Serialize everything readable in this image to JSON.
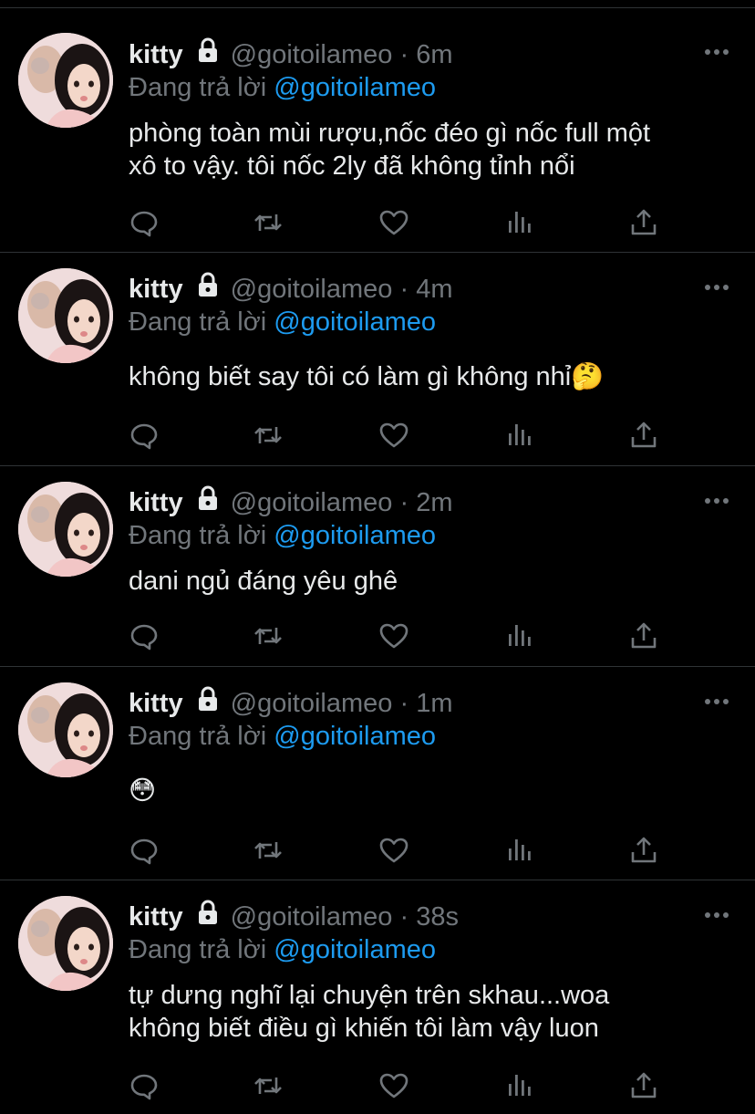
{
  "tweets": [
    {
      "name": "kitty",
      "handle": "@goitoilameo",
      "separator": "·",
      "time": "6m",
      "reply_prefix": "Đang trả lời",
      "reply_to": "@goitoilameo",
      "lines": [
        "phòng toàn mùi rượu,nốc đéo gì nốc full một",
        "xô to vậy. tôi nốc 2ly đã không tỉnh nổi"
      ]
    },
    {
      "name": "kitty",
      "handle": "@goitoilameo",
      "separator": "·",
      "time": "4m",
      "reply_prefix": "Đang trả lời",
      "reply_to": "@goitoilameo",
      "lines": [
        "không biết say tôi có làm gì không nhỉ🤔"
      ]
    },
    {
      "name": "kitty",
      "handle": "@goitoilameo",
      "separator": "·",
      "time": "2m",
      "reply_prefix": "Đang trả lời",
      "reply_to": "@goitoilameo",
      "lines": [
        "dani ngủ đáng yêu ghê"
      ]
    },
    {
      "name": "kitty",
      "handle": "@goitoilameo",
      "separator": "·",
      "time": "1m",
      "reply_prefix": "Đang trả lời",
      "reply_to": "@goitoilameo",
      "lines": [
        "😳"
      ]
    },
    {
      "name": "kitty",
      "handle": "@goitoilameo",
      "separator": "·",
      "time": "38s",
      "reply_prefix": "Đang trả lời",
      "reply_to": "@goitoilameo",
      "lines": [
        "tự dưng nghĩ lại chuyện trên skhau...woa",
        "không biết điều gì khiến tôi làm vậy luon"
      ]
    }
  ],
  "icons": {
    "lock": "lock-icon",
    "more": "more-icon",
    "reply": "reply-icon",
    "retweet": "retweet-icon",
    "like": "like-icon",
    "views": "views-icon",
    "share": "share-icon"
  },
  "colors": {
    "background": "#000000",
    "text": "#e7e9ea",
    "muted": "#71767b",
    "accent": "#1d9bf0",
    "divider": "#2f3336"
  }
}
